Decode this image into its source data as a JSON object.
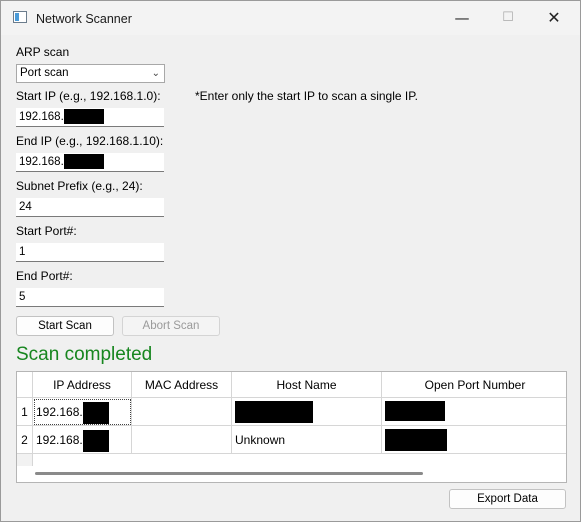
{
  "window": {
    "title": "Network Scanner",
    "controls": {
      "minimize": "—",
      "maximize": "☐",
      "close": "✕"
    }
  },
  "form": {
    "scan_type_label": "ARP scan",
    "scan_type_value": "Port scan",
    "start_ip_label": "Start IP (e.g., 192.168.1.0):",
    "start_ip_hint": "*Enter only the start IP to scan a single IP.",
    "start_ip_value": "192.168.",
    "end_ip_label": "End IP (e.g., 192.168.1.10):",
    "end_ip_value": "192.168.",
    "subnet_label": "Subnet Prefix (e.g., 24):",
    "subnet_value": "24",
    "start_port_label": "Start Port#:",
    "start_port_value": "1",
    "end_port_label": "End Port#:",
    "end_port_value": "5"
  },
  "buttons": {
    "start": "Start Scan",
    "abort": "Abort Scan",
    "export": "Export Data"
  },
  "status": {
    "text": "Scan completed",
    "color": "#17861f"
  },
  "table": {
    "columns": [
      "IP Address",
      "MAC Address",
      "Host Name",
      "Open Port Number"
    ],
    "rows": [
      {
        "row_num": "1",
        "ip": "192.168.",
        "mac": "",
        "host": "",
        "ports": ""
      },
      {
        "row_num": "2",
        "ip": "192.168.",
        "mac": "",
        "host": "Unknown",
        "ports": ""
      }
    ]
  }
}
